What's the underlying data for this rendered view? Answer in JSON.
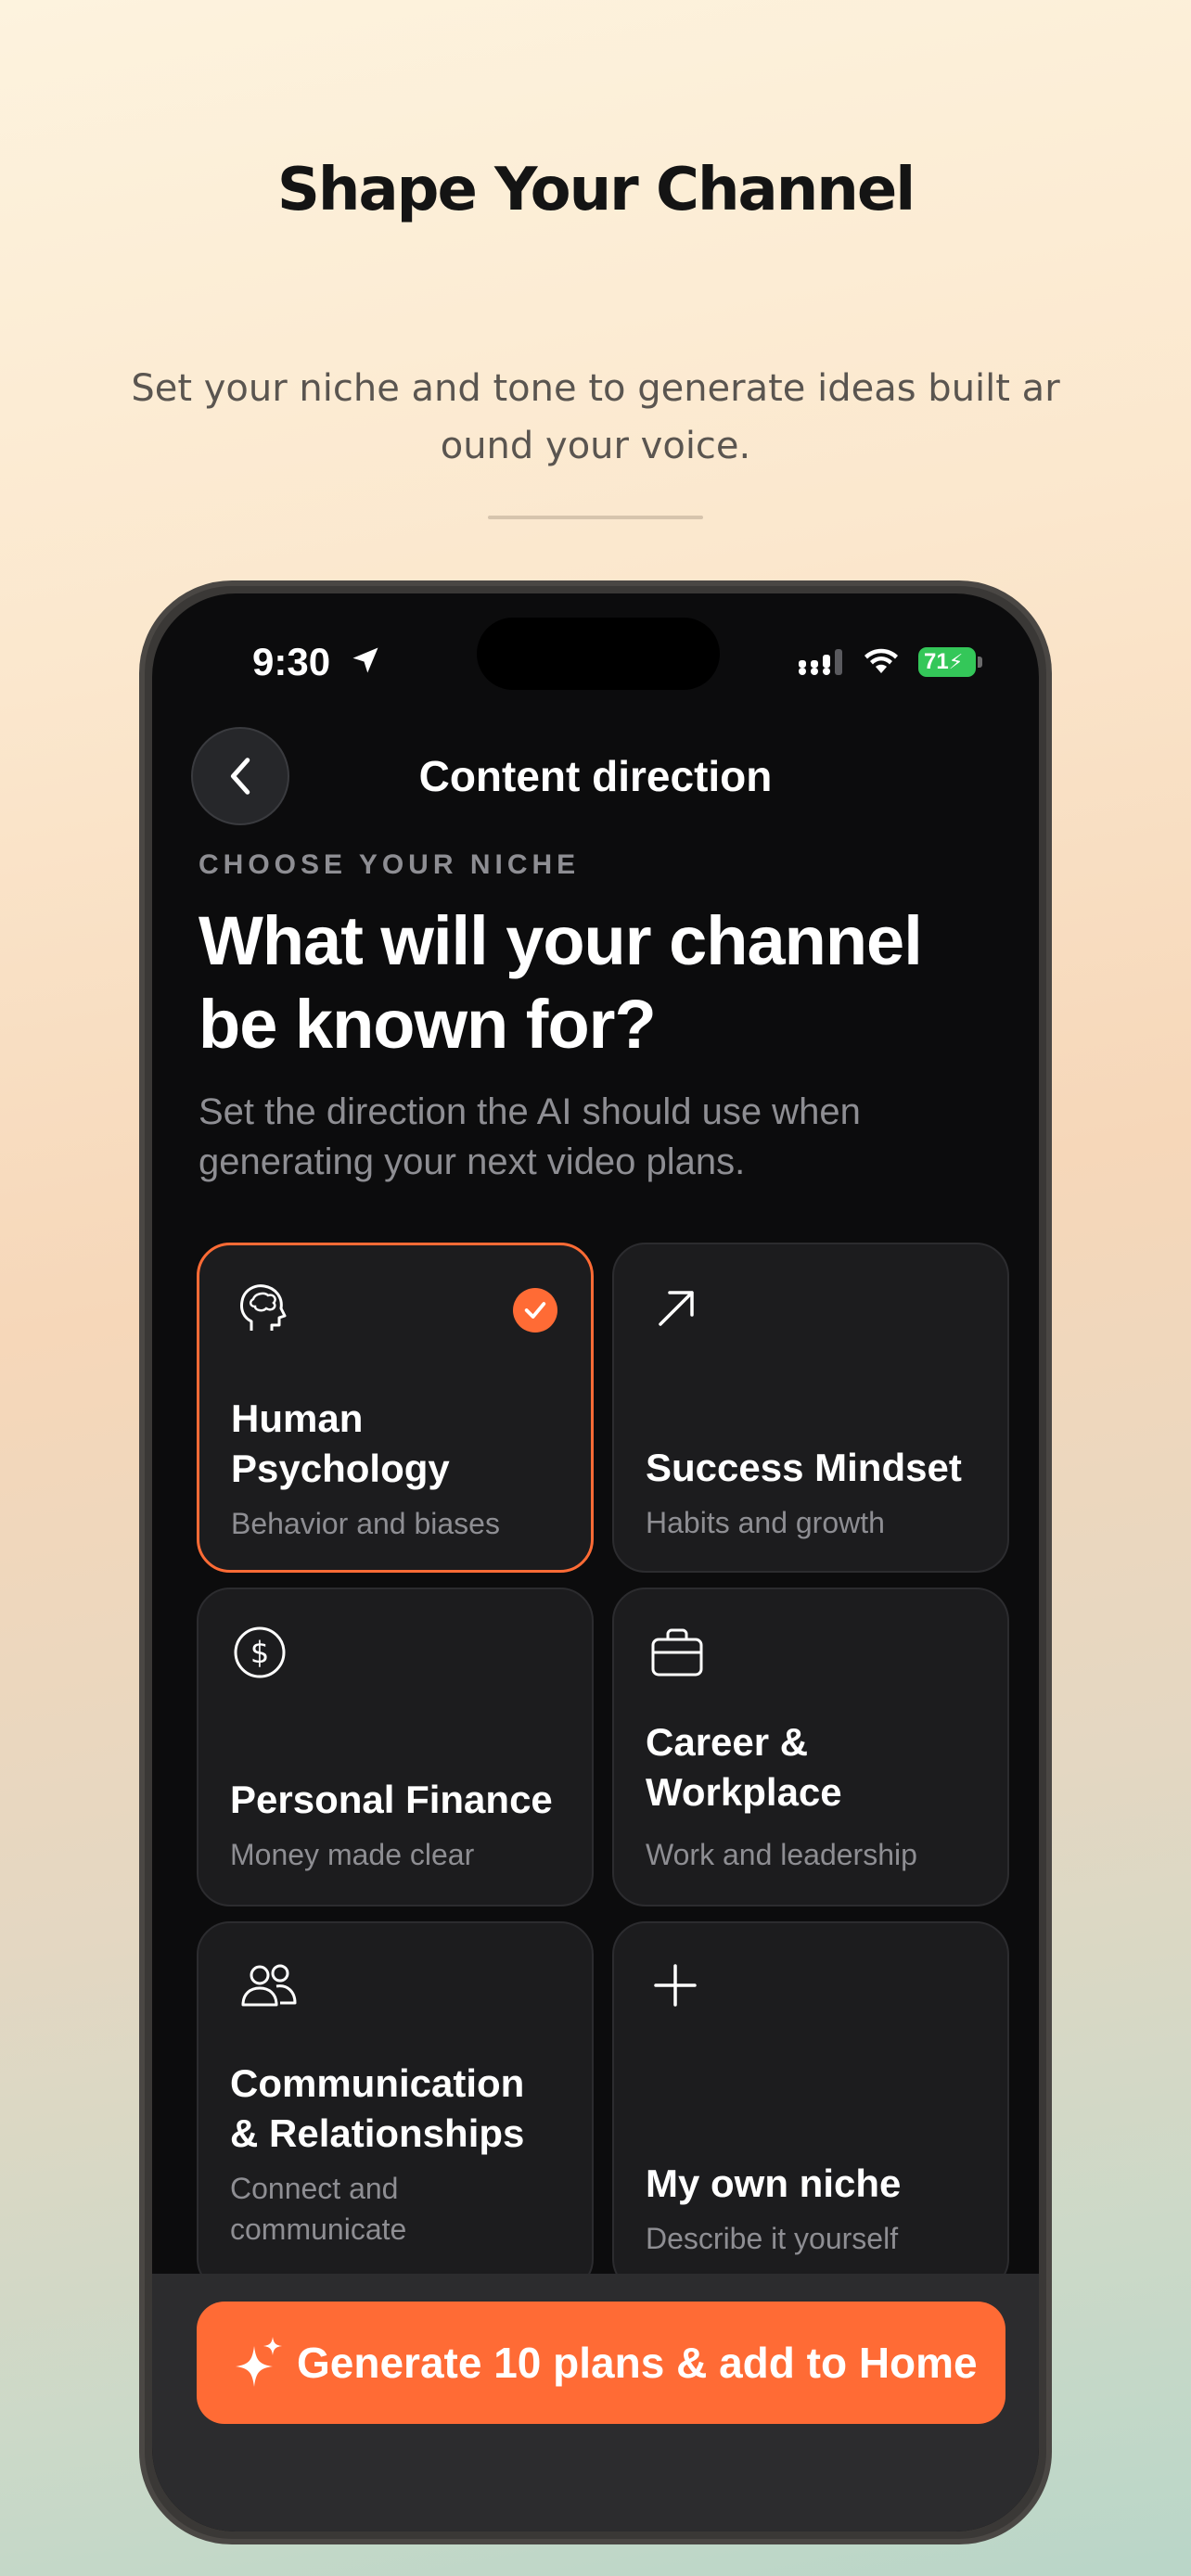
{
  "promo": {
    "title": "Shape Your Channel",
    "subtitle": "Set your niche and tone to generate ideas built around your voice."
  },
  "status_bar": {
    "time": "9:30",
    "battery": "71"
  },
  "nav": {
    "title": "Content direction"
  },
  "content": {
    "eyebrow": "CHOOSE YOUR NICHE",
    "heading": "What will your channel be known for?",
    "description": "Set the direction the AI should use when generating your next video plans."
  },
  "niches": [
    {
      "title": "Human Psychology",
      "subtitle": "Behavior and biases",
      "icon": "brain-icon",
      "selected": true
    },
    {
      "title": "Success Mindset",
      "subtitle": "Habits and growth",
      "icon": "arrow-up-right-icon",
      "selected": false
    },
    {
      "title": "Personal Finance",
      "subtitle": "Money made clear",
      "icon": "dollar-icon",
      "selected": false
    },
    {
      "title": "Career & Workplace",
      "subtitle": "Work and leadership",
      "icon": "briefcase-icon",
      "selected": false
    },
    {
      "title": "Communication & Relationships",
      "subtitle": "Connect and communicate",
      "icon": "people-icon",
      "selected": false
    },
    {
      "title": "My own niche",
      "subtitle": "Describe it yourself",
      "icon": "plus-icon",
      "selected": false
    }
  ],
  "cta": {
    "label": "Generate 10 plans & add to Home",
    "icon": "sparkle-icon"
  },
  "colors": {
    "accent": "#ff6b35",
    "card": "#1c1c1e",
    "screen": "#0c0c0d"
  }
}
